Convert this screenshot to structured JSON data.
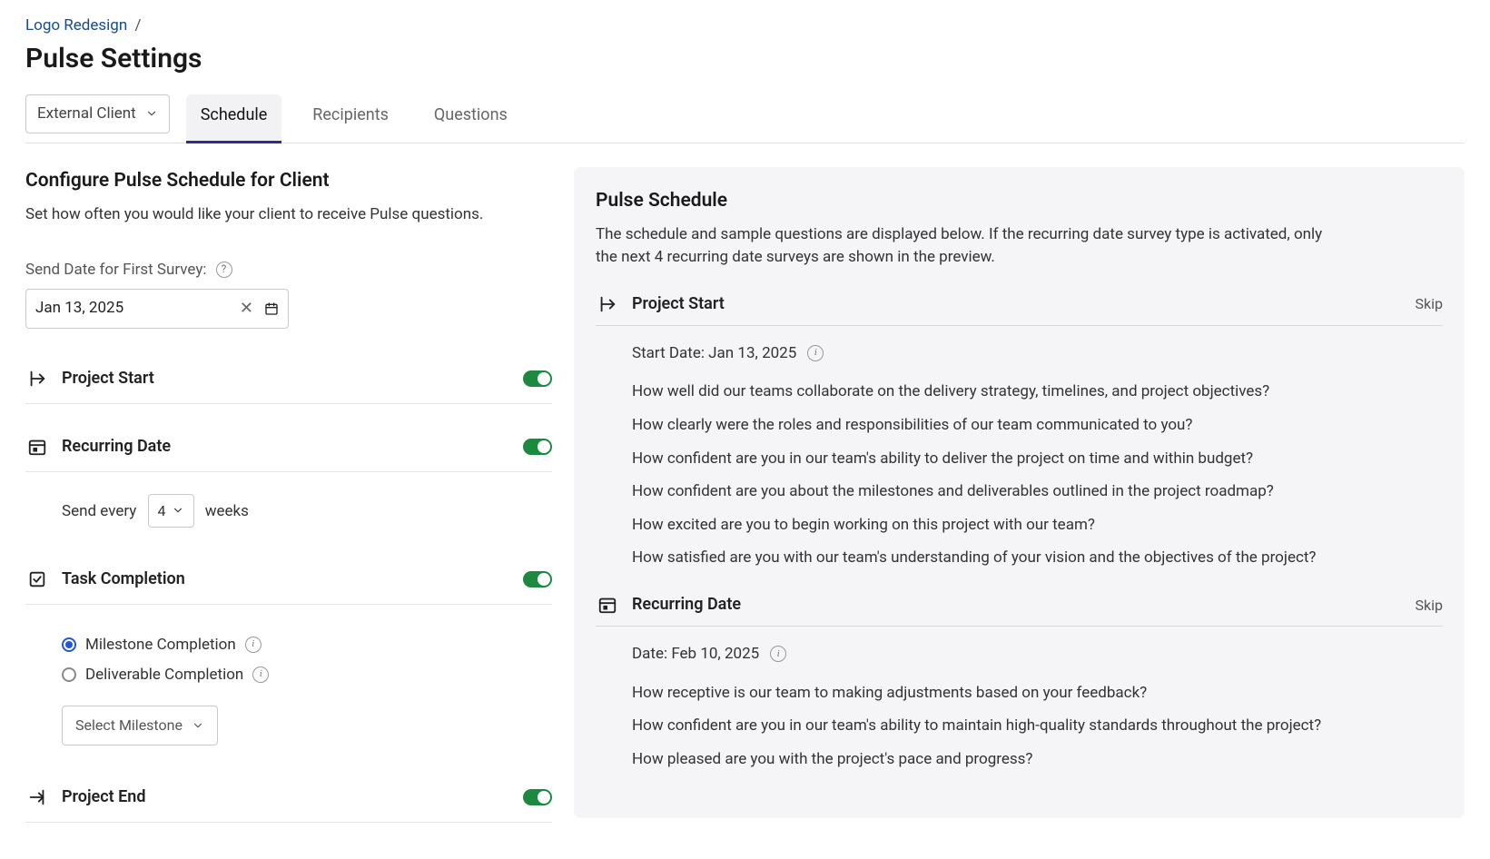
{
  "breadcrumb": {
    "parent": "Logo Redesign",
    "sep": "/"
  },
  "page_title": "Pulse Settings",
  "client_select": "External Client",
  "tabs": {
    "schedule": "Schedule",
    "recipients": "Recipients",
    "questions": "Questions"
  },
  "left": {
    "title": "Configure Pulse Schedule for Client",
    "subtitle": "Set how often you would like your client to receive Pulse questions.",
    "send_date_label": "Send Date for First Survey:",
    "send_date_value": "Jan 13, 2025",
    "toggles": {
      "project_start": "Project Start",
      "recurring_date": "Recurring Date",
      "task_completion": "Task Completion",
      "project_end": "Project End"
    },
    "recurring": {
      "prefix": "Send every",
      "value": "4",
      "suffix": "weeks"
    },
    "task": {
      "radio_milestone": "Milestone Completion",
      "radio_deliverable": "Deliverable Completion",
      "select_placeholder": "Select Milestone"
    }
  },
  "right": {
    "title": "Pulse Schedule",
    "subtitle": "The schedule and sample questions are displayed below. If the recurring date survey type is activated, only the next 4 recurring date surveys are shown in the preview.",
    "skip_label": "Skip",
    "blocks": {
      "project_start": {
        "title": "Project Start",
        "meta": "Start Date: Jan 13, 2025",
        "questions": [
          "How well did our teams collaborate on the delivery strategy, timelines, and project objectives?",
          "How clearly were the roles and responsibilities of our team communicated to you?",
          "How confident are you in our team's ability to deliver the project on time and within budget?",
          "How confident are you about the milestones and deliverables outlined in the project roadmap?",
          "How excited are you to begin working on this project with our team?",
          "How satisfied are you with our team's understanding of your vision and the objectives of the project?"
        ]
      },
      "recurring": {
        "title": "Recurring Date",
        "meta": "Date: Feb 10, 2025",
        "questions": [
          "How receptive is our team to making adjustments based on your feedback?",
          "How confident are you in our team's ability to maintain high-quality standards throughout the project?",
          "How pleased are you with the project's pace and progress?"
        ]
      }
    }
  }
}
